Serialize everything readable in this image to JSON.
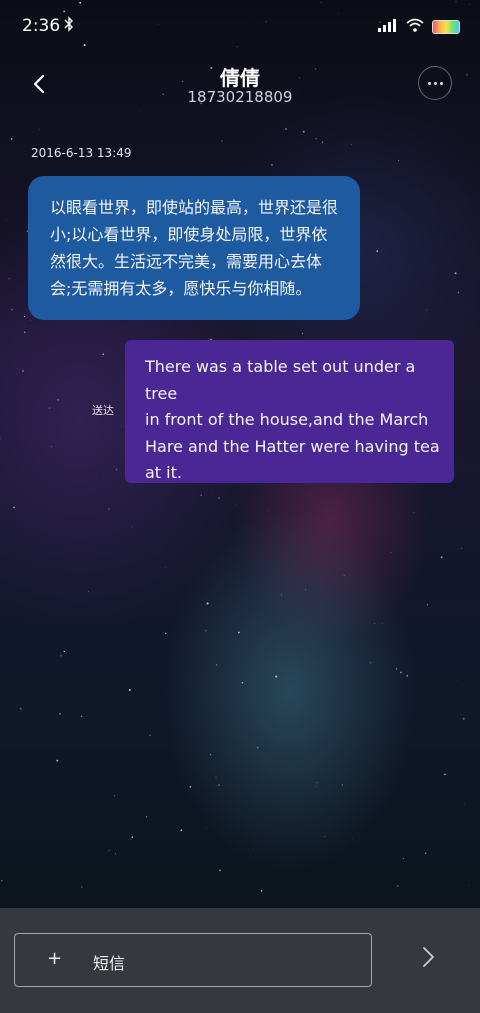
{
  "status_bar": {
    "time": "2:36",
    "bluetooth_icon": "bluetooth-icon",
    "signal_icon": "cellular-signal-icon",
    "wifi_icon": "wifi-icon",
    "battery_icon": "battery-icon"
  },
  "header": {
    "back_icon": "chevron-left-icon",
    "contact_name": "倩倩",
    "contact_number": "18730218809",
    "more_icon": "more-icon"
  },
  "conversation": {
    "timestamp": "2016-6-13 13:49",
    "messages": [
      {
        "direction": "incoming",
        "lines": [
          "以眼看世界，即使站的最高，世界还是很",
          "小;以心看世界，即使身处局限，世界依",
          "然很大。生活远不完美，需要用心去体",
          "会;无需拥有太多，愿快乐与你相随。"
        ],
        "color": "#1e5aa0"
      },
      {
        "direction": "outgoing",
        "lines": [
          "There was a table set out under a tree",
          "in front of the house,and the March",
          "Hare and the Hatter were having tea",
          "at it."
        ],
        "status": "送达",
        "color": "#4b2796"
      }
    ]
  },
  "composer": {
    "plus_icon": "plus-icon",
    "placeholder": "短信",
    "send_icon": "chevron-right-icon"
  }
}
